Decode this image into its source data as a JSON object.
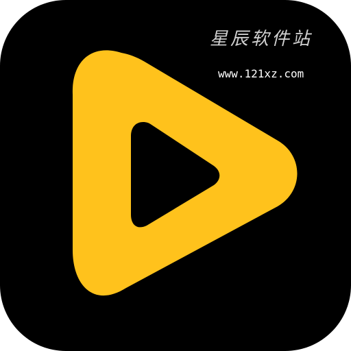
{
  "icon": {
    "name": "play-icon",
    "background_color": "#000000",
    "play_color": "#FFC21C"
  },
  "watermark": {
    "title": "星辰软件站",
    "url": "www.121xz.com"
  }
}
